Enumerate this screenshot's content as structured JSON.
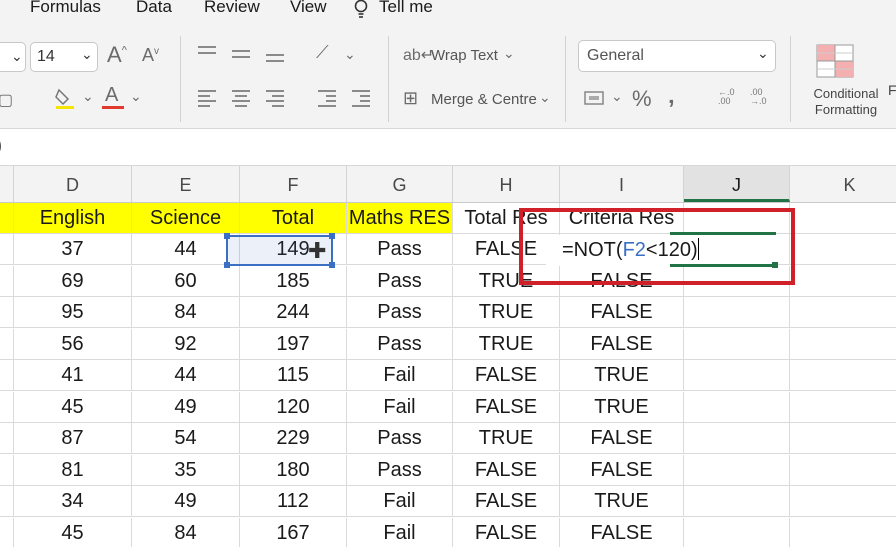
{
  "menu": [
    "Formulas",
    "Data",
    "Review",
    "View",
    "Tell me"
  ],
  "ribbon": {
    "font_size": "14",
    "increase_font": "A",
    "decrease_font": "A",
    "fill_color": "#f5e500",
    "font_color": "#e03a2c",
    "wrap_text_label": "Wrap Text",
    "merge_centre_label": "Merge & Centre",
    "number_format": "General",
    "percent_symbol": "%",
    "comma_symbol": "‚",
    "conditional_formatting_label": "Conditional Formatting"
  },
  "formula_bar": {
    "indicator": ")"
  },
  "columns": [
    "D",
    "E",
    "F",
    "G",
    "H",
    "I",
    "J",
    "K"
  ],
  "selected_column": "J",
  "header_row": [
    "English",
    "Science",
    "Total",
    "Maths RES",
    "Total Res",
    "Criteria Res"
  ],
  "rows": [
    [
      "37",
      "44",
      "149",
      "Pass",
      "FALSE",
      ""
    ],
    [
      "69",
      "60",
      "185",
      "Pass",
      "TRUE",
      "FALSE"
    ],
    [
      "95",
      "84",
      "244",
      "Pass",
      "TRUE",
      "FALSE"
    ],
    [
      "56",
      "92",
      "197",
      "Pass",
      "TRUE",
      "FALSE"
    ],
    [
      "41",
      "44",
      "115",
      "Fail",
      "FALSE",
      "TRUE"
    ],
    [
      "45",
      "49",
      "120",
      "Fail",
      "FALSE",
      "TRUE"
    ],
    [
      "87",
      "54",
      "229",
      "Pass",
      "TRUE",
      "FALSE"
    ],
    [
      "81",
      "35",
      "180",
      "Pass",
      "FALSE",
      "FALSE"
    ],
    [
      "34",
      "49",
      "112",
      "Fail",
      "FALSE",
      "TRUE"
    ],
    [
      "45",
      "84",
      "167",
      "Fail",
      "FALSE",
      "FALSE"
    ]
  ],
  "editing_formula": {
    "prefix": "=NOT(",
    "ref": "F2",
    "suffix": "<120)"
  },
  "colors": {
    "header_fill": "#ffff00",
    "highlight_box": "#d0202a",
    "reference_blue": "#3a6fc4",
    "excel_green": "#217346"
  }
}
